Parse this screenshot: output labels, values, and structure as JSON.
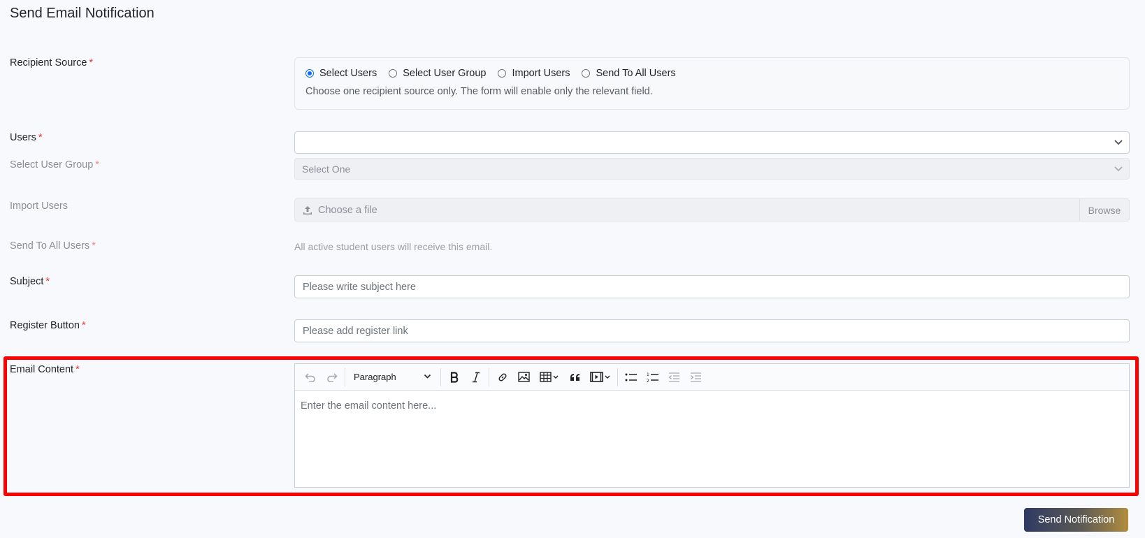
{
  "page": {
    "title": "Send Email Notification"
  },
  "recipient_source": {
    "label": "Recipient Source",
    "required_mark": "*",
    "options": [
      {
        "label": "Select Users",
        "checked": true
      },
      {
        "label": "Select User Group",
        "checked": false
      },
      {
        "label": "Import Users",
        "checked": false
      },
      {
        "label": "Send To All Users",
        "checked": false
      }
    ],
    "hint": "Choose one recipient source only. The form will enable only the relevant field."
  },
  "users": {
    "label": "Users",
    "required_mark": "*",
    "value": ""
  },
  "user_group": {
    "label": "Select User Group",
    "required_mark": "*",
    "value": "Select One"
  },
  "import_users": {
    "label": "Import Users",
    "placeholder": "Choose a file",
    "browse_label": "Browse"
  },
  "send_all": {
    "label": "Send To All Users",
    "required_mark": "*",
    "hint": "All active student users will receive this email."
  },
  "subject": {
    "label": "Subject",
    "required_mark": "*",
    "placeholder": "Please write subject here"
  },
  "register_button": {
    "label": "Register Button",
    "required_mark": "*",
    "placeholder": "Please add register link"
  },
  "email_content": {
    "label": "Email Content",
    "required_mark": "*",
    "toolbar": {
      "paragraph_label": "Paragraph",
      "icons": [
        "undo-icon",
        "redo-icon",
        "bold-icon",
        "italic-icon",
        "link-icon",
        "image-icon",
        "table-icon",
        "blockquote-icon",
        "media-icon",
        "bulleted-list-icon",
        "numbered-list-icon",
        "outdent-icon",
        "indent-icon"
      ]
    },
    "placeholder": "Enter the email content here..."
  },
  "actions": {
    "send_label": "Send Notification"
  },
  "colors": {
    "accent": "#0d6efd",
    "required": "#e53935",
    "highlight": "#ff0000",
    "button_start": "#2e3a63",
    "button_end": "#b18d3e"
  }
}
